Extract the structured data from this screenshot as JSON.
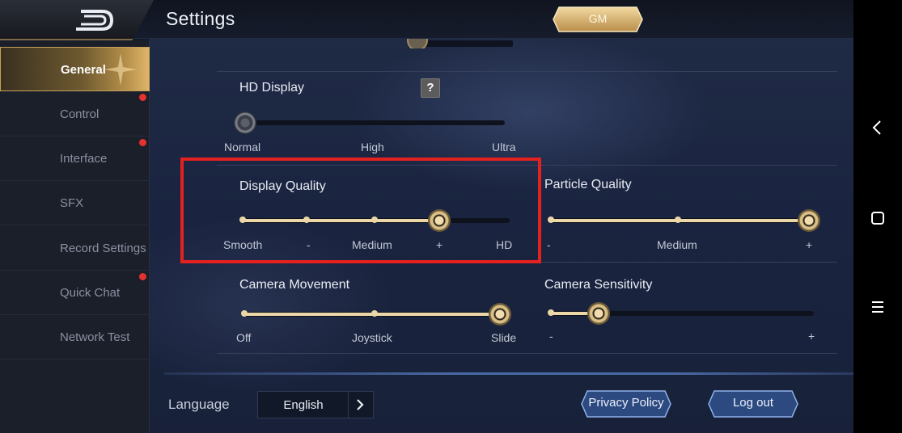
{
  "header": {
    "title": "Settings",
    "gm_label": "GM"
  },
  "sidebar": {
    "items": [
      {
        "label": "General",
        "active": true,
        "badge": false
      },
      {
        "label": "Control",
        "active": false,
        "badge": true
      },
      {
        "label": "Interface",
        "active": false,
        "badge": true
      },
      {
        "label": "SFX",
        "active": false,
        "badge": false
      },
      {
        "label": "Record Settings",
        "active": false,
        "badge": false
      },
      {
        "label": "Quick Chat",
        "active": false,
        "badge": true
      },
      {
        "label": "Network Test",
        "active": false,
        "badge": false
      }
    ]
  },
  "settings": {
    "hd_display": {
      "label": "HD Display",
      "help": "?",
      "ticks": [
        "Normal",
        "High",
        "Ultra"
      ],
      "value_index": 0,
      "enabled": false
    },
    "display_quality": {
      "label": "Display Quality",
      "ticks": [
        "Smooth",
        "-",
        "Medium",
        "+",
        "HD"
      ],
      "value_index": 3
    },
    "particle_quality": {
      "label": "Particle Quality",
      "ticks": [
        "-",
        "Medium",
        "+"
      ],
      "value_index": 2
    },
    "camera_movement": {
      "label": "Camera Movement",
      "ticks": [
        "Off",
        "Joystick",
        "Slide"
      ],
      "value_index": 2
    },
    "camera_sensitivity": {
      "label": "Camera Sensitivity",
      "ticks": [
        "-",
        "+"
      ],
      "value_fraction": 0.2
    }
  },
  "footer": {
    "language_label": "Language",
    "language_value": "English",
    "privacy_label": "Privacy Policy",
    "logout_label": "Log out"
  },
  "icons": {
    "back": "back-arrow-icon",
    "help": "question-icon",
    "language_next": "chevron-right-icon",
    "nav_back": "nav-back-icon",
    "nav_home": "nav-home-icon",
    "nav_menu": "nav-menu-icon"
  },
  "colors": {
    "accent_gold": "#ecd7a8",
    "highlight_red": "#e3211f",
    "badge_red": "#e5312f"
  }
}
